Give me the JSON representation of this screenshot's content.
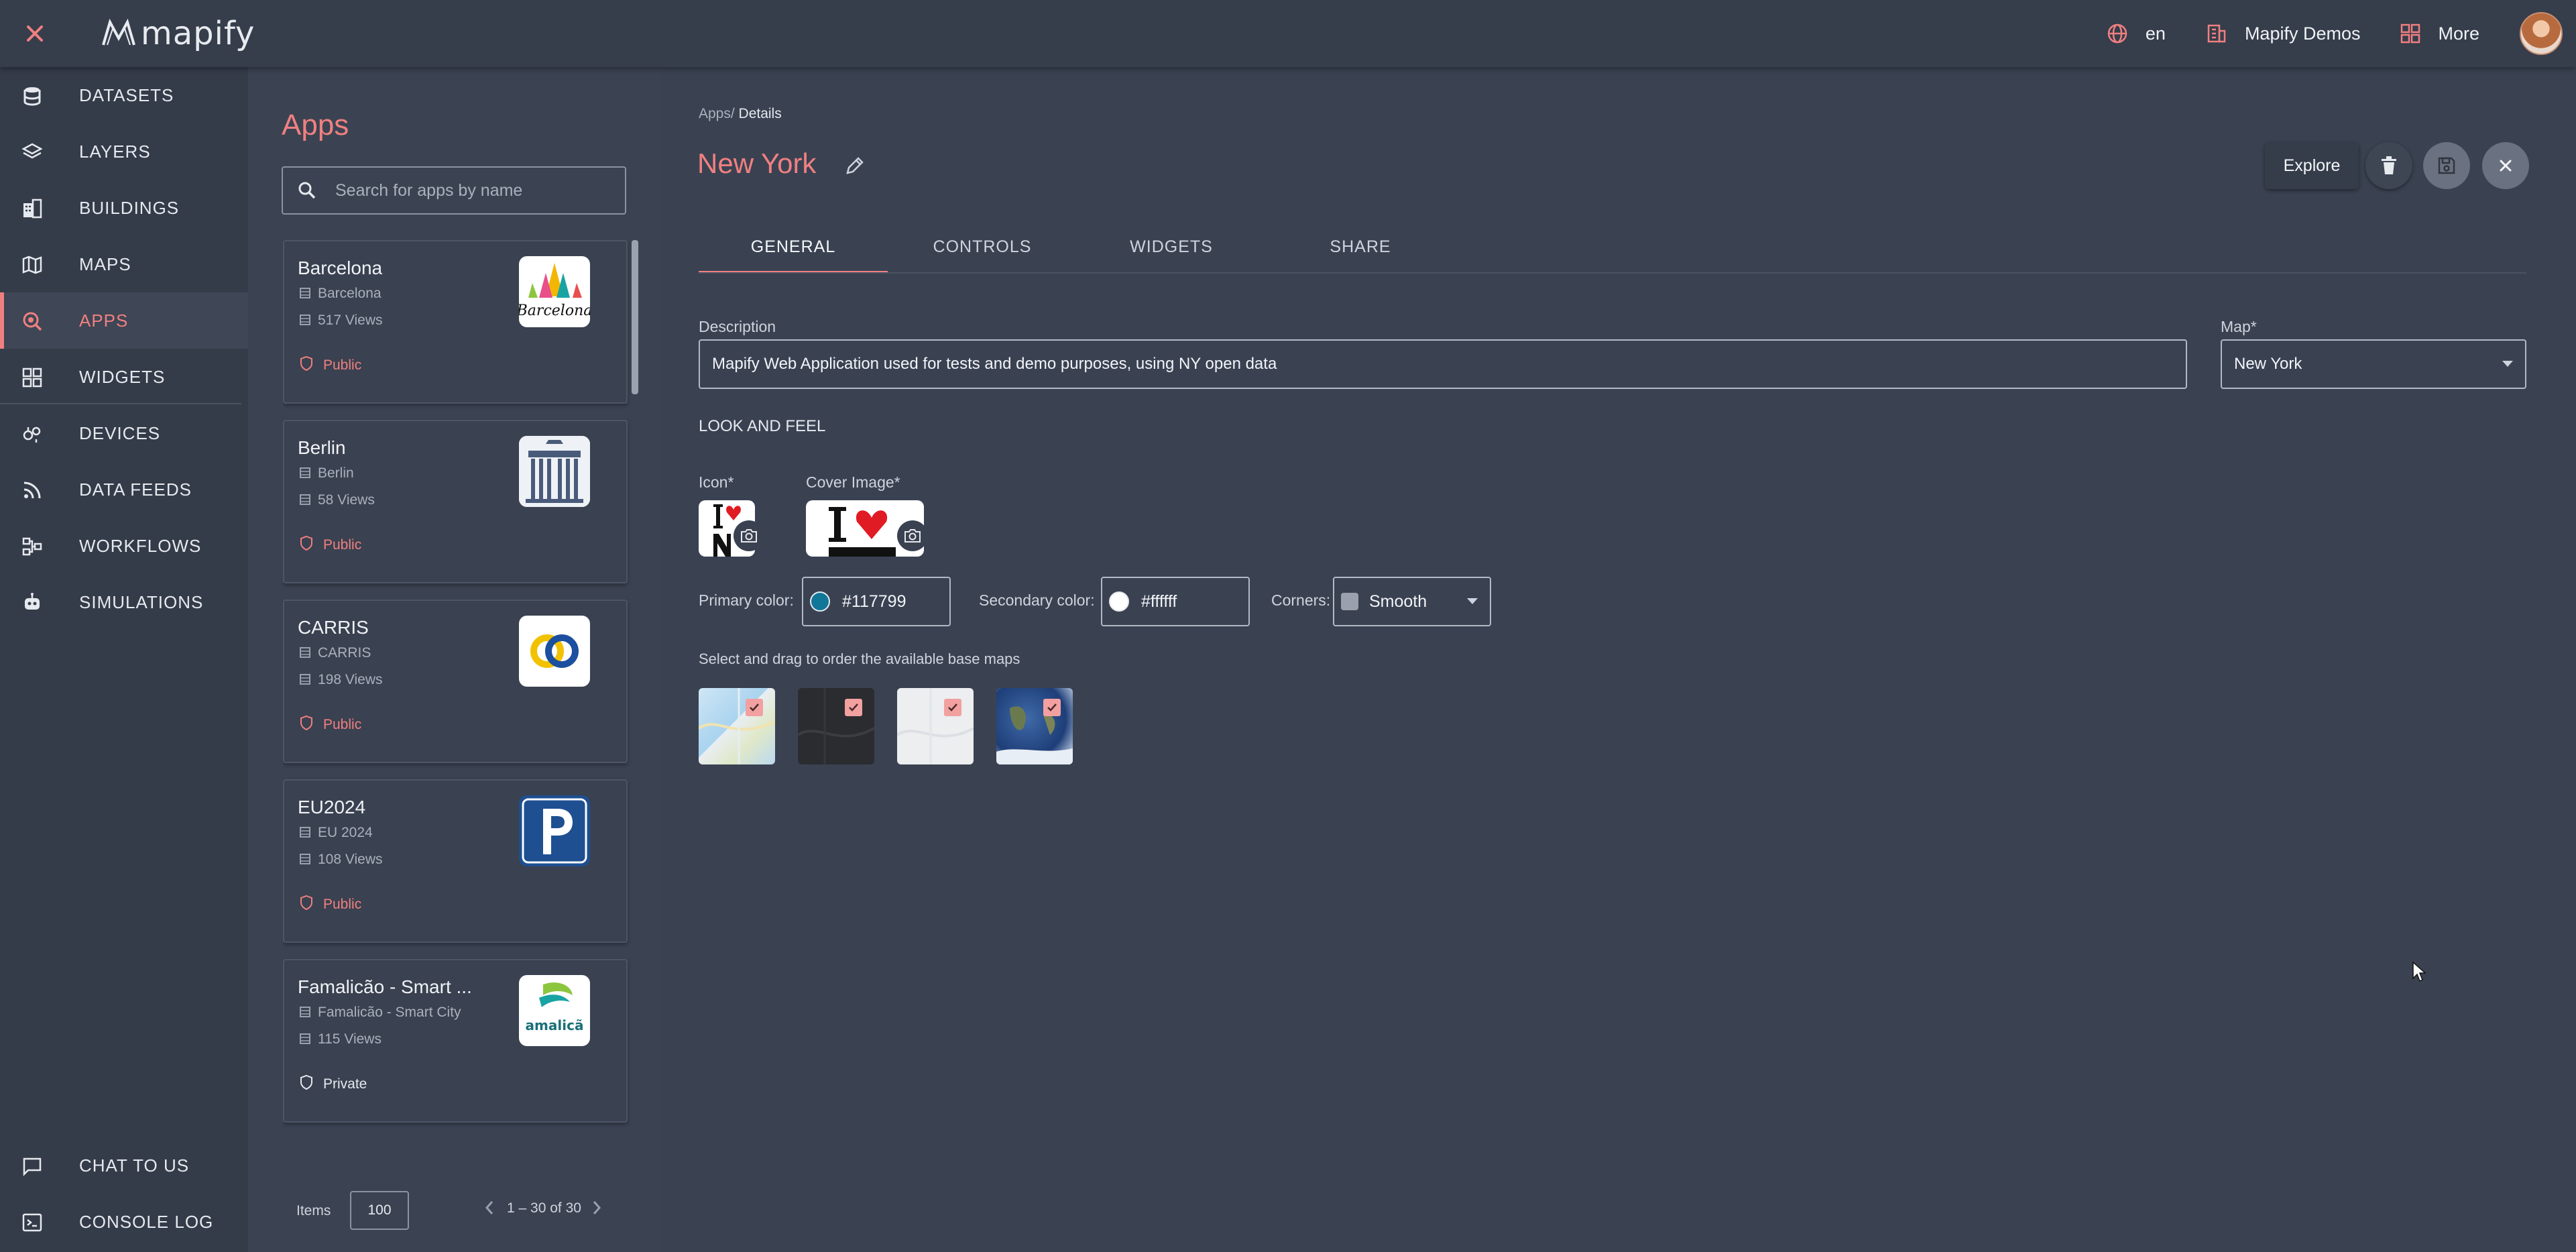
{
  "topbar": {
    "logo_text": "mapify",
    "language": "en",
    "organization": "Mapify Demos",
    "more_label": "More"
  },
  "sidebar": {
    "items": [
      {
        "label": "DATASETS",
        "icon": "database-icon"
      },
      {
        "label": "LAYERS",
        "icon": "layers-icon"
      },
      {
        "label": "BUILDINGS",
        "icon": "buildings-icon"
      },
      {
        "label": "MAPS",
        "icon": "map-icon"
      },
      {
        "label": "APPS",
        "icon": "apps-icon",
        "active": true
      },
      {
        "label": "WIDGETS",
        "icon": "widgets-icon"
      },
      {
        "label": "DEVICES",
        "icon": "devices-icon"
      },
      {
        "label": "DATA FEEDS",
        "icon": "rss-icon"
      },
      {
        "label": "WORKFLOWS",
        "icon": "workflow-icon"
      },
      {
        "label": "SIMULATIONS",
        "icon": "robot-icon"
      }
    ],
    "bottom": [
      {
        "label": "CHAT TO US",
        "icon": "chat-icon"
      },
      {
        "label": "CONSOLE LOG",
        "icon": "terminal-icon"
      }
    ],
    "active_color": "#f08080"
  },
  "apps_panel": {
    "title": "Apps",
    "search_placeholder": "Search for apps by name",
    "apps": [
      {
        "name": "Barcelona",
        "subtitle": "Barcelona",
        "views": "517 Views",
        "visibility": "Public"
      },
      {
        "name": "Berlin",
        "subtitle": "Berlin",
        "views": "58 Views",
        "visibility": "Public"
      },
      {
        "name": "CARRIS",
        "subtitle": "CARRIS",
        "views": "198 Views",
        "visibility": "Public"
      },
      {
        "name": "EU2024",
        "subtitle": "EU 2024",
        "views": "108 Views",
        "visibility": "Public"
      },
      {
        "name": "Famalicão - Smart ...",
        "subtitle": "Famalicão - Smart City",
        "views": "115 Views",
        "visibility": "Private"
      }
    ],
    "pagination": {
      "items_label": "Items",
      "items_value": "100",
      "range": "1 – 30 of 30"
    }
  },
  "detail": {
    "breadcrumb_root": "Apps/",
    "breadcrumb_current": " Details",
    "title": "New York",
    "explore_label": "Explore",
    "tabs": [
      "GENERAL",
      "CONTROLS",
      "WIDGETS",
      "SHARE"
    ],
    "active_tab": "GENERAL",
    "description_label": "Description",
    "description_value": "Mapify Web Application used for tests and demo purposes, using NY open data",
    "map_label": "Map*",
    "map_value": "New York",
    "look_and_feel": "LOOK AND FEEL",
    "icon_label": "Icon*",
    "cover_label": "Cover Image*",
    "primary_color_label": "Primary color:",
    "primary_color_value": "#117799",
    "secondary_color_label": "Secondary color:",
    "secondary_color_value": "#ffffff",
    "corners_label": "Corners:",
    "corners_value": "Smooth",
    "basemaps_hint": "Select and drag to order the available base maps",
    "basemaps": [
      {
        "icon": "light-map-thumbnail",
        "checked": true
      },
      {
        "icon": "dark-map-thumbnail",
        "checked": true
      },
      {
        "icon": "gray-map-thumbnail",
        "checked": true
      },
      {
        "icon": "satellite-map-thumbnail",
        "checked": true
      }
    ]
  }
}
